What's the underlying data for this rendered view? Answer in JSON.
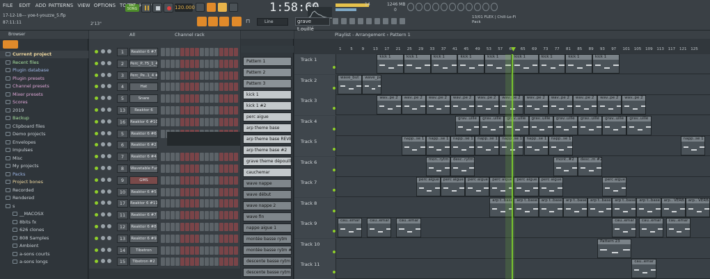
{
  "project": {
    "file": "17-12-18--- yoe-t-youzze_5.flp",
    "time_code": "87:11:11",
    "bpm": "120.000",
    "clock": "1:58:60",
    "clock_unit": "M:S:CS",
    "cpu": "14",
    "mem": "1246 MB",
    "mem2": "0",
    "mode_label": "2'13\""
  },
  "menu": [
    "FILE",
    "EDIT",
    "ADD",
    "PATTERNS",
    "VIEW",
    "OPTIONS",
    "TOOLS",
    "HELP"
  ],
  "transport": {
    "pat": "PAT",
    "song": "SONG"
  },
  "hint_panel": {
    "line1": "13/01 FLEX | Chill-Lo-Fi",
    "line2": "Pack"
  },
  "snap": "Line",
  "current_pattern_tool": "grave t.ouillé",
  "browser": {
    "title": "Browser",
    "items": [
      {
        "label": "Current project",
        "color": "#f0d9a0",
        "bold": true
      },
      {
        "label": "Recent files",
        "color": "#a9e2a0"
      },
      {
        "label": "Plugin database",
        "color": "#9fb8e8"
      },
      {
        "label": "Plugin presets",
        "color": "#e0a8d8"
      },
      {
        "label": "Channel presets",
        "color": "#e0a8d8"
      },
      {
        "label": "Mixer presets",
        "color": "#e0a8d8"
      },
      {
        "label": "Scores",
        "color": "#e0a8d8"
      },
      {
        "label": "2019",
        "color": "#c9d0d5"
      },
      {
        "label": "Backup",
        "color": "#a9e2a0"
      },
      {
        "label": "Clipboard files",
        "color": "#c9d0d5"
      },
      {
        "label": "Demo projects",
        "color": "#c9d0d5"
      },
      {
        "label": "Envelopes",
        "color": "#c9d0d5"
      },
      {
        "label": "Impulses",
        "color": "#c9d0d5"
      },
      {
        "label": "Misc",
        "color": "#c9d0d5"
      },
      {
        "label": "My projects",
        "color": "#c9d0d5"
      },
      {
        "label": "Packs",
        "color": "#9fb8e8"
      },
      {
        "label": "Project bones",
        "color": "#f0d9a0"
      },
      {
        "label": "Recorded",
        "color": "#c9d0d5"
      },
      {
        "label": "Rendered",
        "color": "#c9d0d5"
      },
      {
        "label": "s",
        "color": "#c9d0d5"
      },
      {
        "label": "__MACOSX",
        "color": "#c9d0d5",
        "indent": true
      },
      {
        "label": "8bits fx",
        "color": "#c9d0d5",
        "indent": true
      },
      {
        "label": "626 clones",
        "color": "#c9d0d5",
        "indent": true
      },
      {
        "label": "808 Samples",
        "color": "#c9d0d5",
        "indent": true
      },
      {
        "label": "Ambient",
        "color": "#c9d0d5",
        "indent": true
      },
      {
        "label": "a-sons courts",
        "color": "#c9d0d5",
        "indent": true
      },
      {
        "label": "a-sons longs",
        "color": "#c9d0d5",
        "indent": true
      }
    ]
  },
  "channel_rack": {
    "title": "Channel rack",
    "filter": "All",
    "channels": [
      {
        "num": "1",
        "name": "Reaktor 6 #7"
      },
      {
        "num": "2",
        "name": "Perc_P..75_1_4"
      },
      {
        "num": "3",
        "name": "Perc_Pe..1_4 #2"
      },
      {
        "num": "4",
        "name": "Hat"
      },
      {
        "num": "5",
        "name": "Snare"
      },
      {
        "num": "13",
        "name": "Reaktor 6"
      },
      {
        "num": "16",
        "name": "Reaktor 6 #10"
      },
      {
        "num": "5",
        "name": "Reaktor 6 #6"
      },
      {
        "num": "6",
        "name": "Reaktor 6 #2"
      },
      {
        "num": "7",
        "name": "Reaktor 6 #4"
      },
      {
        "num": "8",
        "name": "Wavetable Fun"
      },
      {
        "num": "9",
        "name": "GMS"
      },
      {
        "num": "10",
        "name": "Reaktor 6 #5"
      },
      {
        "num": "17",
        "name": "Reaktor 6 #11"
      },
      {
        "num": "11",
        "name": "Reaktor 6 #7"
      },
      {
        "num": "12",
        "name": "Reaktor 6 #8"
      },
      {
        "num": "13",
        "name": "Reaktor 6 #9"
      },
      {
        "num": "14",
        "name": "Tibetron"
      },
      {
        "num": "15",
        "name": "Tibetron #2"
      }
    ]
  },
  "patterns": [
    "Pattern 1",
    "Pattern 2",
    "Pattern 3",
    "kick 1",
    "kick 1 #2",
    "perc aigue",
    "arp theme base",
    "arp theme base REVERB",
    "arp theme base #2",
    "grave theme dépouillé",
    "cauchemar",
    "wave nappe",
    "wave début",
    "wave nappe 2",
    "wave fin",
    "nappe aigue 1",
    "montée basse rytm",
    "montée basse rytm #2",
    "descente basse rytm",
    "descente basse rytm #2"
  ],
  "playlist": {
    "title": "Playlist - Arrangement",
    "crumb": "Pattern 1",
    "ruler": [
      "1",
      "5",
      "9",
      "13",
      "17",
      "21",
      "25",
      "29",
      "33",
      "37",
      "41",
      "45",
      "49",
      "53",
      "57",
      "61",
      "65",
      "69",
      "73",
      "77",
      "81",
      "85",
      "89",
      "93",
      "97",
      "101",
      "105",
      "109",
      "113",
      "117",
      "121",
      "125"
    ],
    "tracks": [
      "Track 1",
      "Track 2",
      "Track 3",
      "Track 4",
      "Track 5",
      "Track 6",
      "Track 7",
      "Track 8",
      "Track 9",
      "Track 10",
      "Track 11"
    ],
    "clip_labels": {
      "t1": "kick 1",
      "t2a": "wave_but",
      "t2b": "wave_pae",
      "t3": "wav..pe 2",
      "t4": "grav..uillé",
      "t5": "napp..se 1",
      "t6a": "mon..rytm",
      "t6b": "desc..rytm",
      "t6c": "mont..#2",
      "t6d": "desc..m #2",
      "t7": "perc aigue",
      "t8": "arp t..base",
      "t8b": "arp.. VERB",
      "t9": "cau..emar",
      "t10": "Pattern 23",
      "t11": "cau..emar"
    }
  }
}
